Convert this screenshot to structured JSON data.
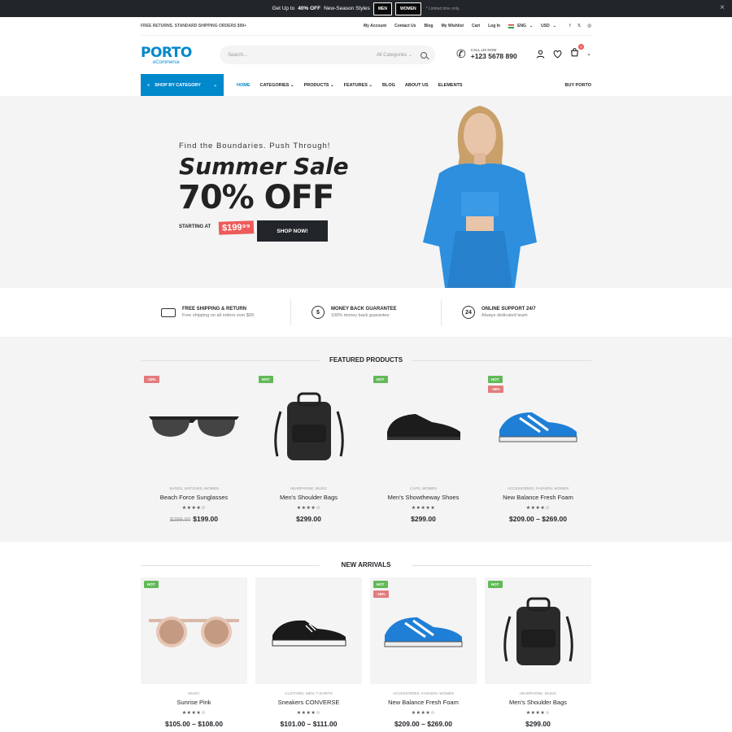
{
  "promo": {
    "pre": "Get Up to",
    "bold": "40% OFF",
    "post": "New-Season Styles",
    "btn_men": "MEN",
    "btn_women": "WOMEN",
    "note": "* Limited time only.",
    "close": "×"
  },
  "util": {
    "shipping": "FREE RETURNS. STANDARD SHIPPING ORDERS $99+",
    "links": [
      "My Account",
      "Contact Us",
      "Blog",
      "My Wishlist",
      "Cart",
      "Log In"
    ],
    "lang": "ENG",
    "currency": "USD",
    "social": [
      "f",
      "𝕏",
      "◎"
    ]
  },
  "header": {
    "logo": "PORTO",
    "logo_sub": "eCommerce",
    "search_placeholder": "Search...",
    "search_category": "All Categories",
    "call_label": "CALL US NOW",
    "phone": "+123 5678 890",
    "cart_count": "0"
  },
  "nav": {
    "shop_by_category": "SHOP BY CATEGORY",
    "items": [
      "HOME",
      "CATEGORIES",
      "PRODUCTS",
      "FEATURES",
      "BLOG",
      "ABOUT US",
      "ELEMENTS"
    ],
    "buy": "BUY PORTO"
  },
  "hero": {
    "tagline": "Find the Boundaries. Push Through!",
    "title": "Summer Sale",
    "discount": "70% OFF",
    "starting_at": "STARTING AT",
    "price": "$199⁹⁹",
    "cta": "SHOP NOW!"
  },
  "features": [
    {
      "title": "FREE SHIPPING & RETURN",
      "sub": "Free shipping on all orders over $99.",
      "icon": "truck-icon"
    },
    {
      "title": "MONEY BACK GUARANTEE",
      "sub": "100% money back guarantee",
      "icon": "dollar-icon"
    },
    {
      "title": "ONLINE SUPPORT 24/7",
      "sub": "Always dedicated team",
      "icon": "support-24-icon"
    }
  ],
  "featured": {
    "title": "FEATURED PRODUCTS",
    "products": [
      {
        "label": "-33%",
        "cats": "SHOES, WATCHES, WOMEN",
        "name": "Beach Force Sunglasses",
        "stars": "★★★★☆",
        "old": "$299.00",
        "price": "$199.00"
      },
      {
        "label": "HOT",
        "cats": "HEADPHONE, MUSIC",
        "name": "Men's Shoulder Bags",
        "stars": "★★★★☆",
        "price": "$299.00"
      },
      {
        "label": "HOT",
        "cats": "CAPS, WOMEN",
        "name": "Men's Showtheway Shoes",
        "stars": "★★★★★",
        "price": "$299.00"
      },
      {
        "label": "HOT",
        "label2": "-18%",
        "cats": "ACCESSORIES, FASHION, WOMEN",
        "name": "New Balance Fresh Foam",
        "stars": "★★★★☆",
        "price": "$209.00 – $269.00"
      }
    ]
  },
  "arrivals": {
    "title": "NEW ARRIVALS",
    "products": [
      {
        "label": "HOT",
        "cats": "MUSIC",
        "name": "Sunrise Pink",
        "stars": "★★★★☆",
        "price": "$105.00 – $108.00"
      },
      {
        "cats": "CLOTHING, MEN, T-SHIRTS",
        "name": "Sneakers CONVERSE",
        "stars": "★★★★☆",
        "price": "$101.00 – $111.00"
      },
      {
        "label": "HOT",
        "label2": "-18%",
        "cats": "ACCESSORIES, FASHION, WOMEN",
        "name": "New Balance Fresh Foam",
        "stars": "★★★★☆",
        "price": "$209.00 – $269.00"
      },
      {
        "label": "HOT",
        "cats": "HEADPHONE, MUSIC",
        "name": "Men's Shoulder Bags",
        "stars": "★★★★☆",
        "price": "$299.00"
      }
    ]
  },
  "colors": {
    "accent": "#0088cc",
    "dark": "#222529",
    "hot": "#62b959",
    "sale": "#e27c7c",
    "hero_bg": "#f4f4f4",
    "model_top": "#2d8fdd"
  }
}
